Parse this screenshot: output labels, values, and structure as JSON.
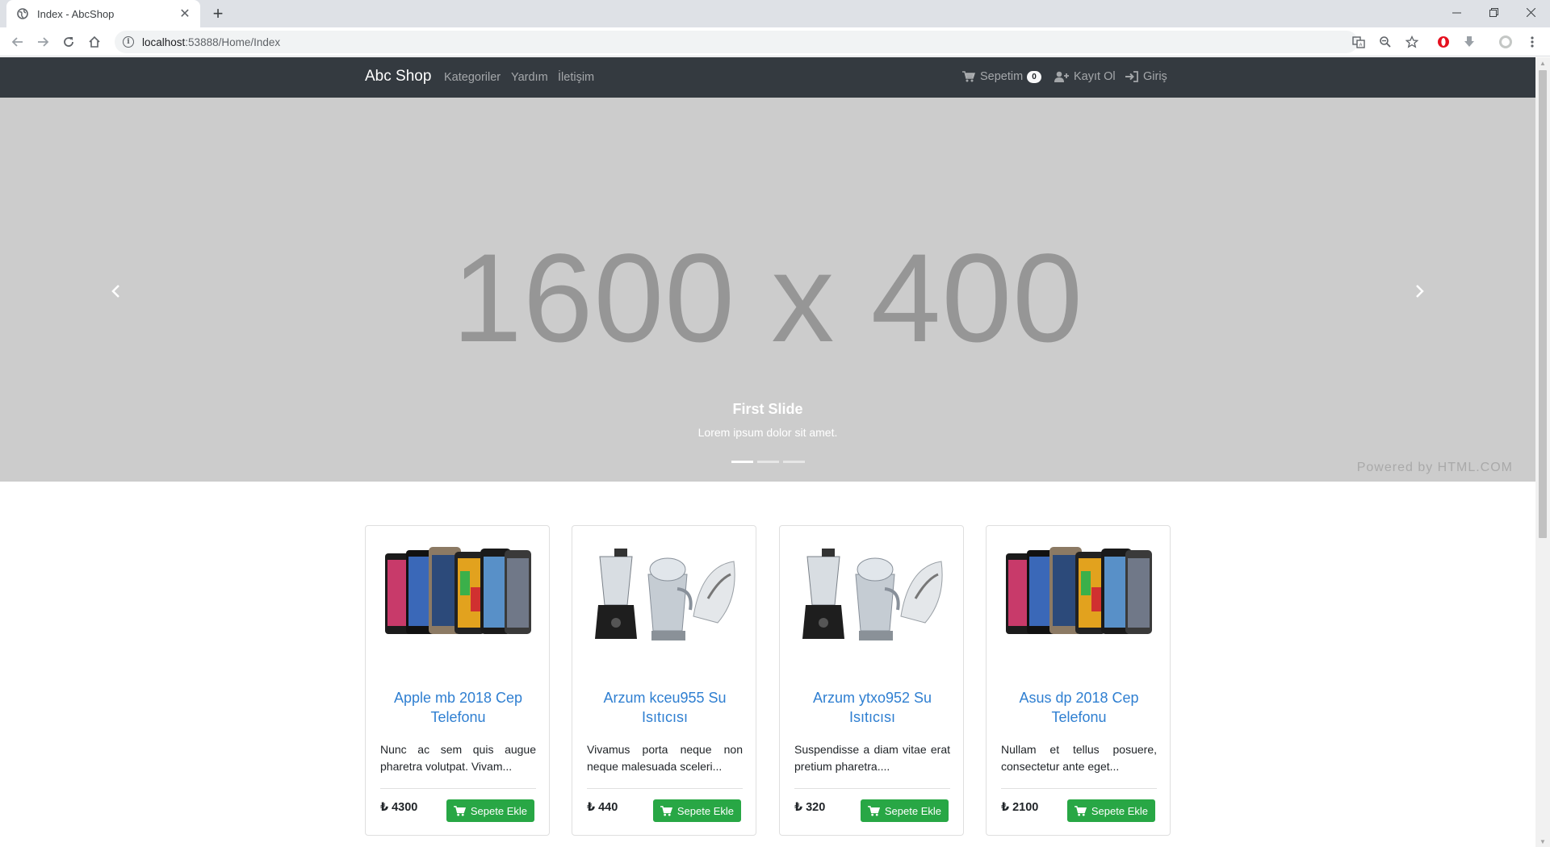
{
  "browser": {
    "tab_title": "Index - AbcShop",
    "url_host": "localhost",
    "url_path": ":53888/Home/Index"
  },
  "navbar": {
    "brand": "Abc Shop",
    "links": [
      "Kategoriler",
      "Yardım",
      "İletişim"
    ],
    "cart_label": "Sepetim",
    "cart_count": "0",
    "register_label": "Kayıt Ol",
    "login_label": "Giriş"
  },
  "carousel": {
    "placeholder": "1600 x 400",
    "caption_title": "First Slide",
    "caption_text": "Lorem ipsum dolor sit amet.",
    "powered_by": "Powered by HTML.COM",
    "slide_count": 3,
    "active_slide": 1
  },
  "products": [
    {
      "image": "phones",
      "title": "Apple mb 2018 Cep Telefonu",
      "description": "Nunc ac sem quis augue pharetra volutpat. Vivam...",
      "price": "₺ 4300",
      "button": "Sepete Ekle"
    },
    {
      "image": "appliances",
      "title": "Arzum kceu955 Su Isıtıcısı",
      "description": "Vivamus porta neque non neque malesuada sceleri...",
      "price": "₺ 440",
      "button": "Sepete Ekle"
    },
    {
      "image": "appliances",
      "title": "Arzum ytxo952 Su Isıtıcısı",
      "description": "Suspendisse a diam vitae erat pretium pharetra....",
      "price": "₺ 320",
      "button": "Sepete Ekle"
    },
    {
      "image": "phones",
      "title": "Asus dp 2018 Cep Telefonu",
      "description": "Nullam et tellus posuere, consectetur ante eget...",
      "price": "₺ 2100",
      "button": "Sepete Ekle"
    }
  ],
  "colors": {
    "navbar_bg": "#343a40",
    "carousel_bg": "#cccccc",
    "link_blue": "#2f7fd1",
    "button_green": "#28a745"
  }
}
